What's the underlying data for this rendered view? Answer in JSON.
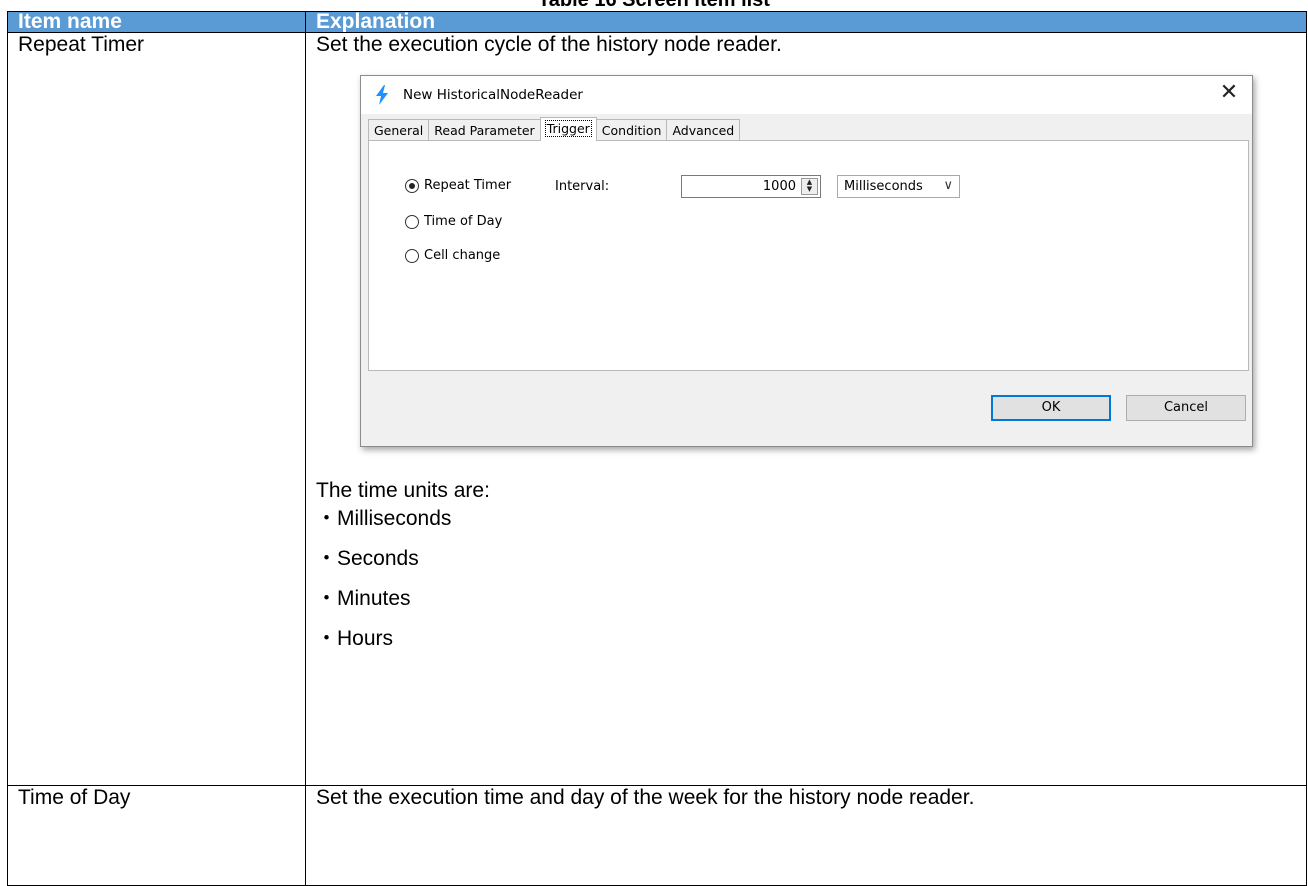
{
  "document": {
    "caption": "Table 16   Screen item list",
    "headers": {
      "item": "Item name",
      "explanation": "Explanation"
    },
    "rows": {
      "repeat_timer": {
        "item": "Repeat Timer",
        "explanation": "Set the execution cycle of the history node reader.",
        "units_intro": "The time units are:",
        "units": [
          "・Milliseconds",
          "・Seconds",
          "・Minutes",
          "・Hours"
        ]
      },
      "time_of_day": {
        "item": "Time of Day",
        "explanation": "Set the execution time and day of the week for the history node reader."
      }
    }
  },
  "dialog": {
    "title": "New HistoricalNodeReader",
    "title_icon": "lightning-bolt-icon",
    "close_glyph": "✕",
    "accent": "#0078d7",
    "tabs": [
      "General",
      "Read Parameter",
      "Trigger",
      "Condition",
      "Advanced"
    ],
    "active_tab": "Trigger",
    "options": {
      "repeat_timer": "Repeat Timer",
      "time_of_day": "Time of Day",
      "cell_change": "Cell change"
    },
    "selected_option": "Repeat Timer",
    "interval_label": "Interval:",
    "interval_value": "1000",
    "unit_selected": "Milliseconds",
    "buttons": {
      "ok": "OK",
      "cancel": "Cancel"
    }
  },
  "colors": {
    "header_bg": "#5b9bd5",
    "header_text": "#ffffff"
  }
}
